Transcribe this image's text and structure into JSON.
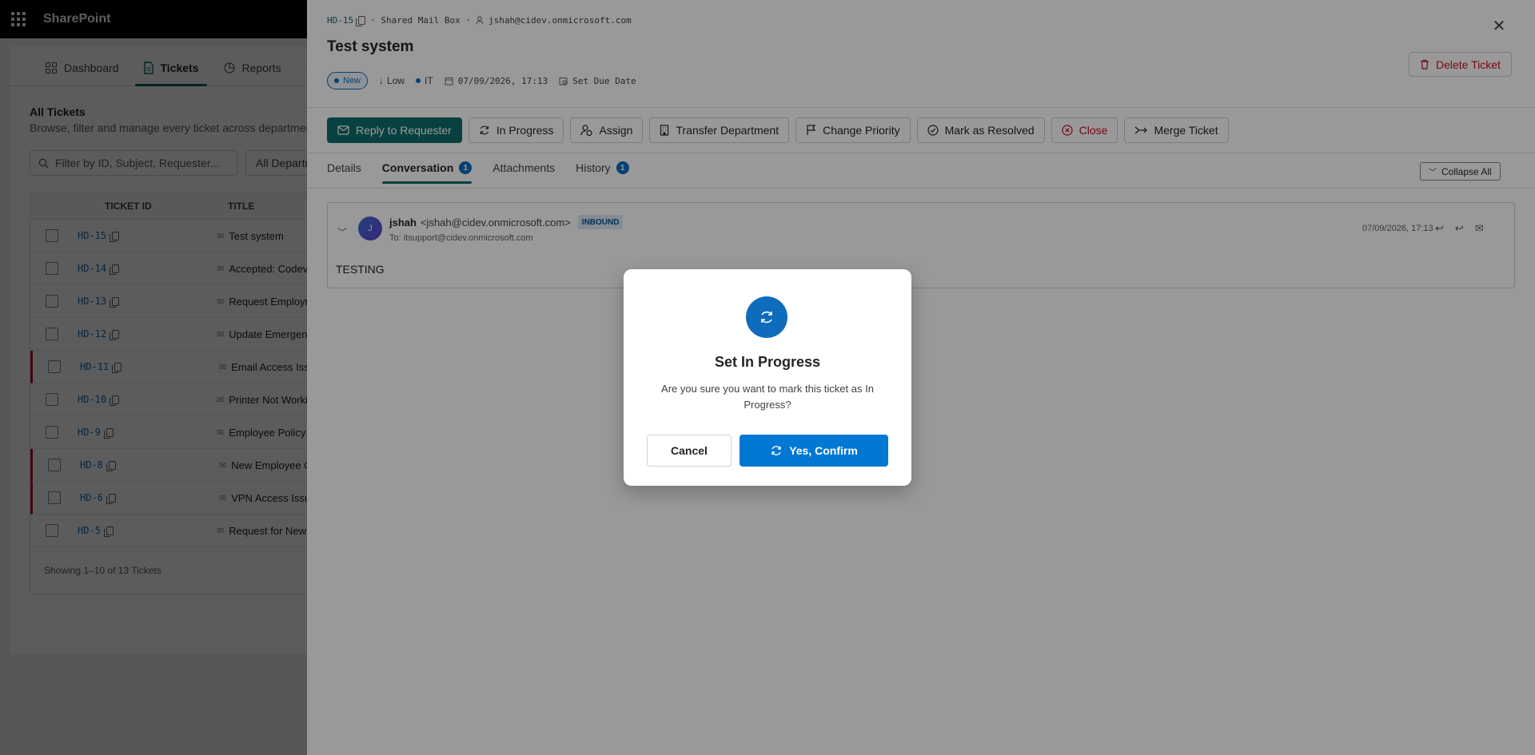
{
  "suite": {
    "title": "SharePoint"
  },
  "app": {
    "nav": [
      {
        "label": "Dashboard",
        "icon": "grid-icon",
        "active": false
      },
      {
        "label": "Tickets",
        "icon": "document-icon",
        "active": true
      },
      {
        "label": "Reports",
        "icon": "chart-icon",
        "active": false
      }
    ],
    "section_title": "All Tickets",
    "section_subtitle": "Browse, filter and manage every ticket across departments",
    "filter_placeholder": "Filter by ID, Subject, Requester...",
    "dept_filter": "All Departments",
    "columns": {
      "id": "TICKET ID",
      "title": "TITLE"
    },
    "rows": [
      {
        "id": "HD-15",
        "title": "Test system",
        "flag": false
      },
      {
        "id": "HD-14",
        "title": "Accepted: Codevision",
        "flag": false
      },
      {
        "id": "HD-13",
        "title": "Request Employment",
        "flag": false
      },
      {
        "id": "HD-12",
        "title": "Update Emergency C",
        "flag": false
      },
      {
        "id": "HD-11",
        "title": "Email Access Issue",
        "flag": true
      },
      {
        "id": "HD-10",
        "title": "Printer Not Working",
        "flag": false
      },
      {
        "id": "HD-9",
        "title": "Employee Policy Que",
        "flag": false
      },
      {
        "id": "HD-8",
        "title": "New Employee Onb",
        "flag": true
      },
      {
        "id": "HD-6",
        "title": "VPN Access Issue",
        "flag": true
      },
      {
        "id": "HD-5",
        "title": "Request for New Mo",
        "flag": false
      }
    ],
    "footer": "Showing 1–10 of 13 Tickets"
  },
  "panel": {
    "ticket_id": "HD-15",
    "source": "· Shared Mail Box ·",
    "requester_email": "jshah@cidev.onmicrosoft.com",
    "title": "Test system",
    "delete_label": "Delete Ticket",
    "status": "New",
    "priority": "Low",
    "department": "IT",
    "created": "07/09/2026, 17:13",
    "due_date_label": "Set Due Date",
    "actions": {
      "reply": "Reply to Requester",
      "in_progress": "In Progress",
      "assign": "Assign",
      "transfer": "Transfer Department",
      "change_priority": "Change Priority",
      "resolve": "Mark as Resolved",
      "close": "Close",
      "merge": "Merge Ticket"
    },
    "tabs": {
      "details": "Details",
      "conversation": "Conversation",
      "conversation_count": "1",
      "attachments": "Attachments",
      "history": "History",
      "history_count": "1"
    },
    "collapse_all": "Collapse All",
    "message": {
      "avatar": "J",
      "name": "jshah",
      "address": "<jshah@cidev.onmicrosoft.com>",
      "direction": "INBOUND",
      "to": "To: itsupport@cidev.onmicrosoft.com",
      "date": "07/09/2026, 17:13",
      "body": "TESTING"
    }
  },
  "dialog": {
    "title": "Set In Progress",
    "message": "Are you sure you want to mark this ticket as In Progress?",
    "cancel": "Cancel",
    "confirm": "Yes, Confirm"
  },
  "colors": {
    "brand_teal": "#0f6c6c",
    "primary_blue": "#0078d4",
    "danger": "#c50f1f"
  }
}
